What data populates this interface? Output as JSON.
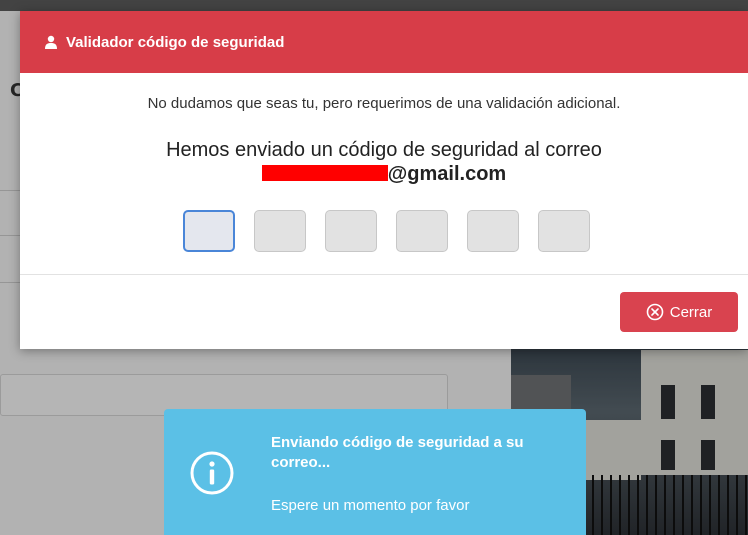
{
  "background": {
    "fragment_text": "C"
  },
  "modal": {
    "title": "Validador código de seguridad",
    "title_icon": "user-icon",
    "intro": "No dudamos que seas tu, pero requerimos de una validación adicional.",
    "sent_text": "Hemos enviado un código de seguridad al correo",
    "email_suffix": "@gmail.com",
    "code_boxes": [
      "",
      "",
      "",
      "",
      "",
      ""
    ],
    "close_label": "Cerrar",
    "close_icon": "x-circle-icon",
    "header_color": "#d73d48",
    "button_color": "#d9434f"
  },
  "toast": {
    "icon": "info-icon",
    "title": "Enviando código de seguridad a su correo...",
    "message": "Espere un momento por favor",
    "color": "#5bc0e6"
  }
}
